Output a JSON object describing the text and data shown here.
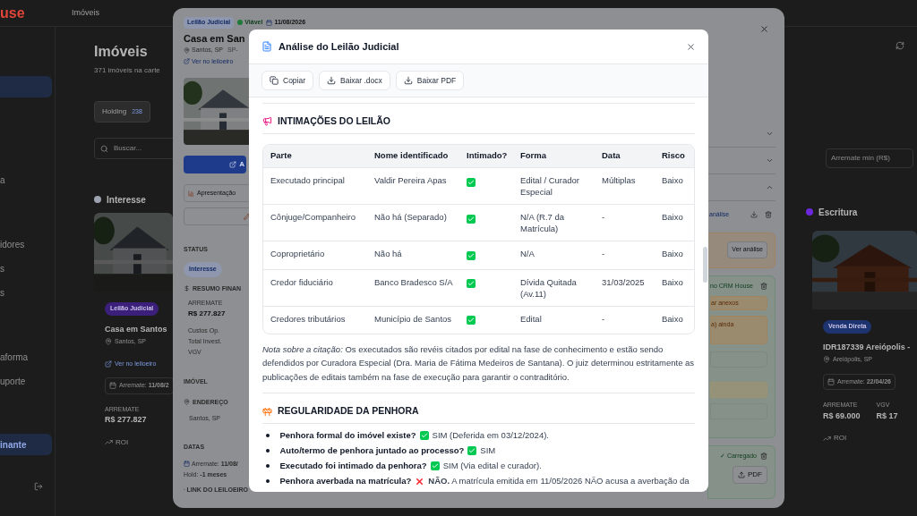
{
  "app": {
    "logo": "use",
    "breadcrumb": "Imóveis"
  },
  "sidebar": {
    "groups": [
      {
        "items": [
          {
            "label": "a"
          }
        ]
      },
      {
        "items": [
          {
            "label": "idores"
          },
          {
            "label": "s"
          },
          {
            "label": "s"
          }
        ]
      },
      {
        "items": [
          {
            "label": "aforma"
          },
          {
            "label": "uporte"
          }
        ]
      }
    ],
    "plan_label": "inante"
  },
  "page": {
    "title": "Imóveis",
    "subtitle": "371 imóveis na carte",
    "tabs": [
      {
        "label": "Holding",
        "count": "238",
        "selected": true
      }
    ],
    "search": {
      "placeholder": "Buscar..."
    },
    "filter": {
      "placeholder": "Arremate min (R$)"
    }
  },
  "columns": [
    {
      "title": "Interesse",
      "color": "#9ca3af",
      "card": {
        "badge": "Leilão Judicial",
        "color": "#3b1f7a",
        "title": "Casa em Santos",
        "location": "Santos, SP",
        "link": "Ver no leiloeiro",
        "date": "Arremate: **11/08/2**",
        "metrics": [
          {
            "label": "ARREMATE",
            "value": "R$ 277.827"
          }
        ],
        "roi": "ROI"
      }
    },
    {
      "title": "Escritura",
      "color": "#6d28d9",
      "card": {
        "badge": "Venda Direta",
        "color": "#1e3470",
        "title": "IDR187339 Areiópolis -",
        "location": "Areiópolis, SP",
        "date": "Arremate: **22/04/26**",
        "metrics": [
          {
            "label": "ARREMATE",
            "value": "R$ 69.000"
          },
          {
            "label": "VGV",
            "value": "R$ 17"
          }
        ],
        "roi": "ROI"
      }
    }
  ],
  "drawer": {
    "badges": [
      {
        "label": "Leilão Judicial",
        "kind": "tag"
      },
      {
        "label": "Viável",
        "kind": "status"
      },
      {
        "label": "11/08/2026",
        "kind": "date"
      }
    ],
    "title": "Casa em San",
    "location": "Santos, SP",
    "code": "SP-",
    "link": "Ver no leiloeiro",
    "primary_button": "A",
    "presentation_button": "Apresentação",
    "status": {
      "heading": "STATUS",
      "value": "Interesse"
    },
    "finance": {
      "heading": "RESUMO FINAN",
      "metric": {
        "label": "ARREMATE",
        "value": "R$ 277.827"
      },
      "rows": [
        "Custos Op.",
        "Total Invest.",
        "VGV"
      ]
    },
    "property": {
      "heading": "IMÓVEL",
      "address_heading": "ENDEREÇO",
      "address": "Santos, SP"
    },
    "dates": {
      "heading": "DATAS",
      "arremate": "Arremate: **11/08/**",
      "hold": "Hold: **-1 meses**"
    },
    "link_heading": "LINK DO LEILOEIRO",
    "accordions": [
      {
        "expanded": false
      },
      {
        "expanded": false
      },
      {
        "expanded": true
      }
    ],
    "analysis_link": "análise",
    "view_analysis": "Ver análise",
    "crm": "no CRM House",
    "warnings": [
      "ar anexos",
      "a) ainda"
    ],
    "loaded": "✓ Carregado",
    "pdf_button": "PDF"
  },
  "modal": {
    "title": "Análise do Leilão Judicial",
    "actions": [
      {
        "label": "Copiar",
        "kind": "copy"
      },
      {
        "label": "Baixar .docx",
        "kind": "download"
      },
      {
        "label": "Baixar PDF",
        "kind": "download"
      }
    ],
    "sections": [
      {
        "kind": "table",
        "heading": "INTIMAÇÕES DO LEILÃO",
        "columns": [
          "Parte",
          "Nome identificado",
          "Intimado?",
          "Forma",
          "Data",
          "Risco"
        ],
        "rows": [
          {
            "parte": "Executado principal",
            "nome": "Valdir Pereira Apas",
            "intimado": true,
            "forma": "Edital / Curador Especial",
            "data": "Múltiplas",
            "risco": "Baixo"
          },
          {
            "parte": "Cônjuge/Companheiro",
            "nome": "Não há (Separado)",
            "intimado": true,
            "forma": "N/A (R.7 da Matrícula)",
            "data": "-",
            "risco": "Baixo"
          },
          {
            "parte": "Coproprietário",
            "nome": "Não há",
            "intimado": true,
            "forma": "N/A",
            "data": "-",
            "risco": "Baixo"
          },
          {
            "parte": "Credor fiduciário",
            "nome": "Banco Bradesco S/A",
            "intimado": true,
            "forma": "Dívida Quitada (Av.11)",
            "data": "31/03/2025",
            "risco": "Baixo"
          },
          {
            "parte": "Credores tributários",
            "nome": "Município de Santos",
            "intimado": true,
            "forma": "Edital",
            "data": "-",
            "risco": "Baixo"
          }
        ],
        "note": "*Nota sobre a citação:* Os executados são revéis citados por edital na fase de conhecimento e estão sendo defendidos por Curadora Especial (Dra. Maria de Fátima Medeiros de Santana). O juiz determinou estritamente as publicações de editais também na fase de execução para garantir o contraditório."
      },
      {
        "kind": "list",
        "heading": "REGULARIDADE DA PENHORA",
        "items": [
          {
            "question": "Penhora formal do imóvel existe?",
            "ok": true,
            "answer": "SIM (Deferida em 03/12/2024)."
          },
          {
            "question": "Auto/termo de penhora juntado ao processo?",
            "ok": true,
            "answer": "SIM"
          },
          {
            "question": "Executado foi intimado da penhora?",
            "ok": true,
            "answer": "SIM (Via edital e curador)."
          },
          {
            "question": "Penhora averbada na matrícula?",
            "ok": false,
            "answer": "**NÃO.** A matrícula emitida em 11/05/2026 NÃO acusa a averbação da"
          }
        ]
      }
    ]
  }
}
